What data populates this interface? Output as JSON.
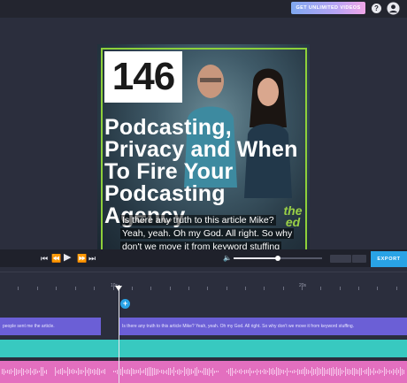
{
  "topbar": {
    "upgrade_label": "GET UNLIMITED VIDEOS",
    "help_glyph": "?",
    "icons": [
      "help-icon",
      "account-icon"
    ]
  },
  "video": {
    "episode_number": "146",
    "title_lines": [
      "Podcasting,",
      "Privacy and When",
      "To Fire Your",
      "Podcasting",
      "Agency"
    ],
    "brand": "the ed",
    "caption_lines": [
      "Is there any truth to this article Mike?",
      "Yeah, yeah. Oh my God. All right. So why",
      "don't we move it from keyword stuffing"
    ],
    "accent_color": "#8dd03a"
  },
  "controls": {
    "icons": [
      "skip-back-icon",
      "rewind-icon",
      "play-icon",
      "fast-forward-icon",
      "skip-forward-icon",
      "volume-icon"
    ],
    "volume_level": 0.5,
    "export_label": "EXPORT",
    "export_color": "#29a3e6"
  },
  "timeline": {
    "ruler_labels": [
      "10s",
      "20s"
    ],
    "add_glyph": "+",
    "clips": [
      {
        "text": "people sent me the article."
      },
      {
        "text": "Is there any truth to this article Mike? Yeah, yeah. Oh my God. All right. So why don't we move it from keyword stuffing."
      }
    ],
    "colors": {
      "subtitle": "#6b5fd6",
      "teal": "#38c9c0",
      "audio": "#e36fbf"
    }
  }
}
